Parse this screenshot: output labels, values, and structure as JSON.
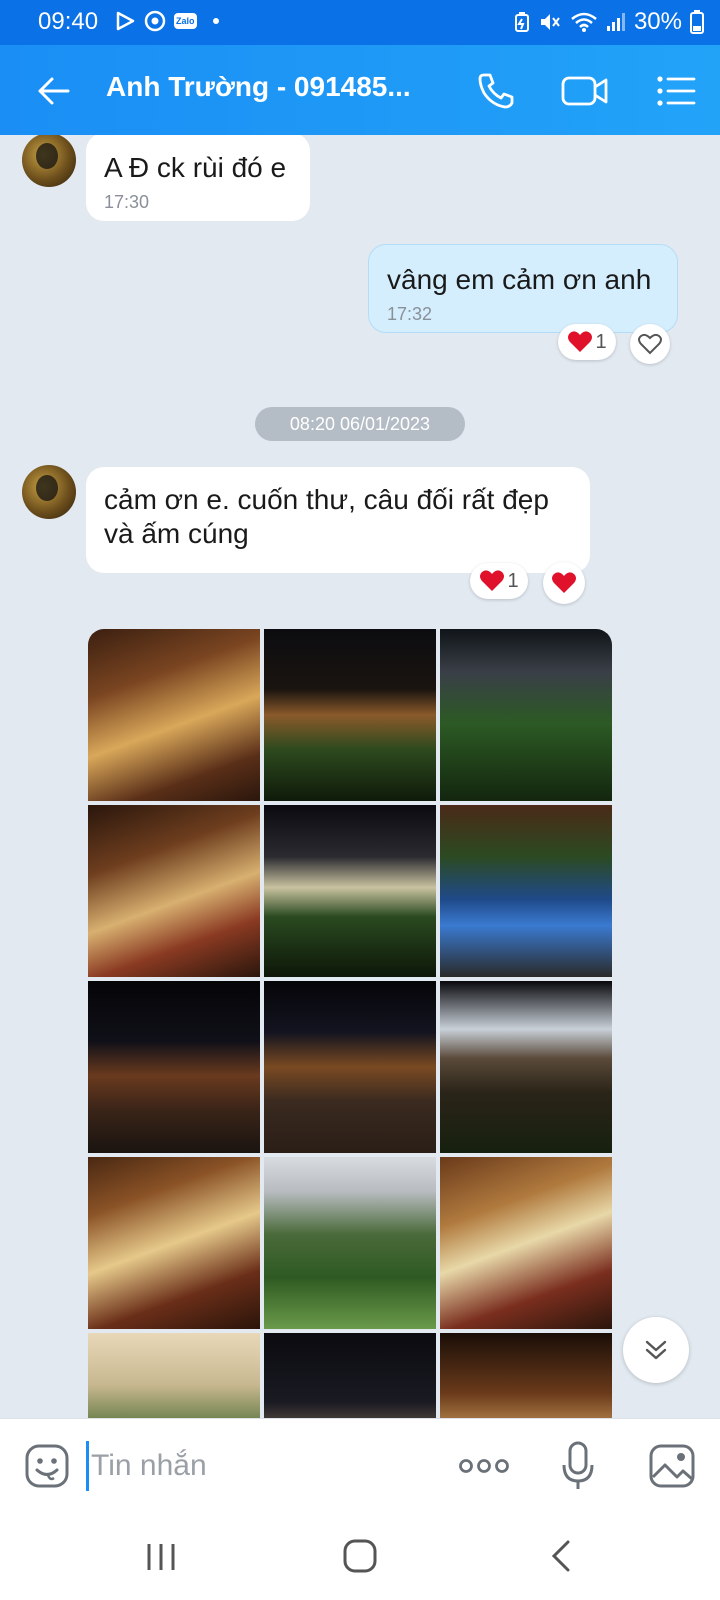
{
  "status_bar": {
    "time": "09:40",
    "zalo_badge": "Zalo",
    "battery": "30%",
    "icons": [
      "play-icon",
      "chrome-icon",
      "zalo-icon",
      "dot-icon",
      "battery-saver-icon",
      "mute-icon",
      "wifi-icon",
      "signal-icon",
      "battery-icon"
    ]
  },
  "header": {
    "title": "Anh Trường - 091485...",
    "icons": [
      "back-arrow-icon",
      "phone-icon",
      "video-call-icon",
      "list-menu-icon"
    ]
  },
  "messages": [
    {
      "direction": "incoming",
      "text": "A Đ ck rùi đó e",
      "time": "17:30"
    },
    {
      "direction": "outgoing",
      "text": "vâng em cảm ơn anh",
      "time": "17:32",
      "reactions": [
        {
          "emoji": "heart",
          "count": "1"
        }
      ],
      "react_button": "heart-outline-icon"
    },
    {
      "direction": "incoming",
      "text": "cảm ơn e. cuốn thư, câu đối rất đẹp và ấm cúng",
      "reactions": [
        {
          "emoji": "heart",
          "count": "1"
        }
      ],
      "react_button": "heart-filled-icon"
    }
  ],
  "date_divider": "08:20 06/01/2023",
  "photo_grid": {
    "columns": 3,
    "visible_photos": 15
  },
  "input_bar": {
    "placeholder": "Tin nhắn",
    "icons": [
      "emoji-icon",
      "more-icon",
      "microphone-icon",
      "image-icon"
    ]
  },
  "nav_bar": {
    "icons": [
      "recent-apps-icon",
      "home-icon",
      "back-icon"
    ]
  },
  "colors": {
    "status_bar": "#0b71e6",
    "header": "#1a8ef5",
    "chat_background": "#e2e9f1",
    "outgoing_bubble": "#d5eefe",
    "heart": "#e0112b"
  }
}
